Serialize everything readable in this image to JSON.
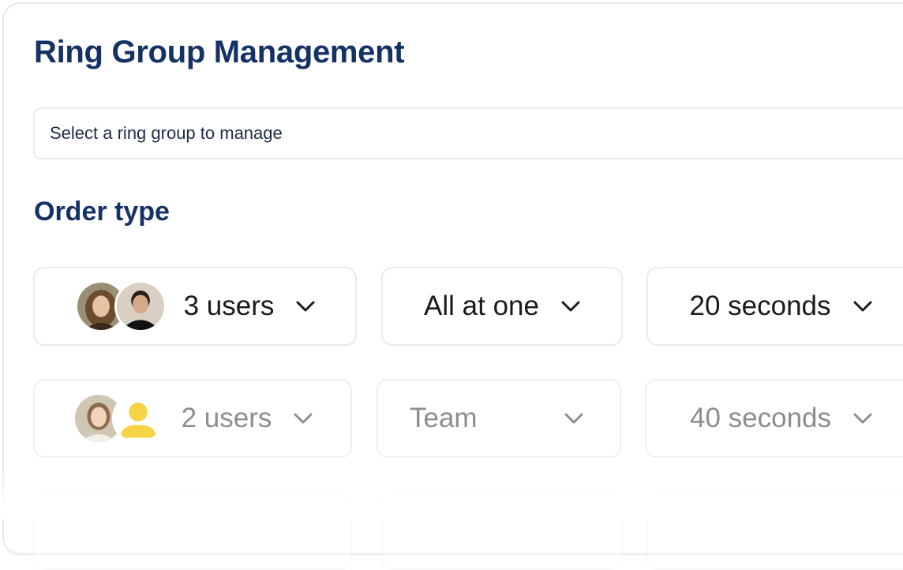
{
  "page": {
    "title": "Ring Group Management",
    "section_title": "Order type"
  },
  "ring_group_select": {
    "value": "Select a ring group to manage"
  },
  "rows": [
    {
      "users_label": "3 users",
      "order_label": "All at one",
      "timeout_label": "20 seconds",
      "style": "active"
    },
    {
      "users_label": "2 users",
      "order_label": "Team",
      "timeout_label": "40 seconds",
      "style": "muted"
    }
  ],
  "colors": {
    "heading": "#143266",
    "placeholder_avatar": "#f7d447"
  },
  "icons": [
    "chevron-down-icon",
    "user-avatar",
    "user-placeholder-icon"
  ]
}
